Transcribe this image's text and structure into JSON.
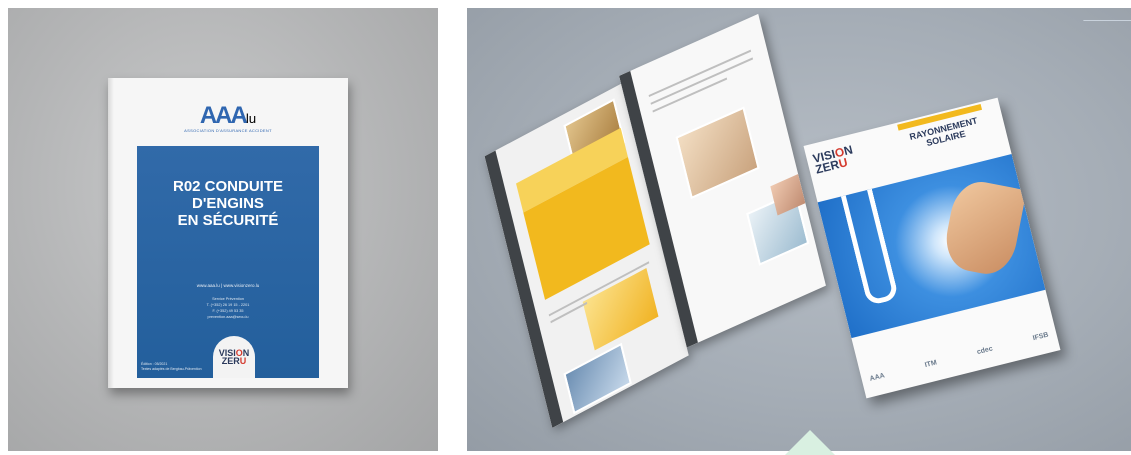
{
  "left_cover": {
    "logo": "AAA",
    "logo_suffix": "lu",
    "logo_sub": "ASSOCIATION D'ASSURANCE ACCIDENT",
    "title_lines": [
      "R02 CONDUITE",
      "D'ENGINS",
      "EN SÉCURITÉ"
    ],
    "web": "www.aaa.lu | www.visionzero.lu",
    "contact_lines": [
      "Service Prévention",
      "T. (+352) 26 19 15 - 2201",
      "F. (+352) 49 53 35",
      "prevention.aaa@secu.lu"
    ],
    "footer_lines": [
      "Édition : 05/2021",
      "Textes adaptés de Bergbau-Prävention"
    ],
    "badge_top": "VISI",
    "badge_o": "O",
    "badge_n": "N",
    "badge_bottom": "ZER",
    "badge_u": "U"
  },
  "right_scene": {
    "vz_top": "VISI",
    "vz_o": "O",
    "vz_n": "N",
    "vz_bottom": "ZER",
    "vz_u": "U",
    "closed_title_line1": "RAYONNEMENT",
    "closed_title_line2": "SOLAIRE",
    "logos": [
      "AAA",
      "ITM",
      "cdec",
      "IFSB"
    ]
  },
  "colors": {
    "brand_blue": "#235f9c",
    "accent_yellow": "#f2b91e",
    "vision_zero_red": "#d43b2f"
  }
}
